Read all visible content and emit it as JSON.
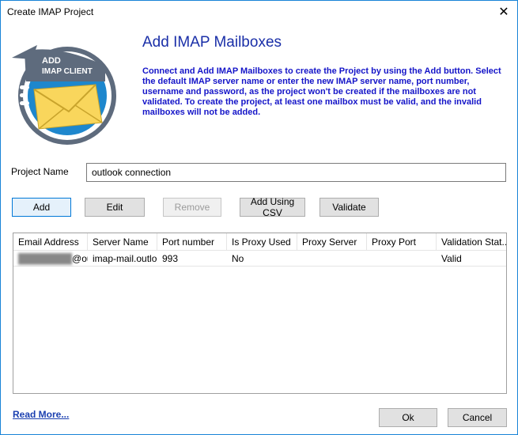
{
  "window": {
    "title": "Create IMAP Project",
    "close_glyph": "✕"
  },
  "logo": {
    "line1": "ADD",
    "line2": "IMAP CLIENT",
    "icon": "envelope-icon"
  },
  "header": {
    "title": "Add IMAP Mailboxes",
    "description": "Connect and Add IMAP Mailboxes to create the Project by using the Add button. Select the default IMAP server name or enter the new IMAP server name, port number, username and password, as the project won't be created if the mailboxes are not validated. To create the project, at least one mailbox must be valid, and the invalid mailboxes will not be added."
  },
  "project": {
    "label": "Project Name",
    "value": "outlook connection"
  },
  "toolbar": {
    "add": "Add",
    "edit": "Edit",
    "remove": "Remove",
    "add_csv": "Add Using CSV",
    "validate": "Validate"
  },
  "grid": {
    "columns": [
      "Email Address",
      "Server Name",
      "Port number",
      "Is Proxy Used",
      "Proxy Server",
      "Proxy Port",
      "Validation Stat..."
    ],
    "rows": [
      {
        "email_hidden": "████████",
        "email_visible": "@outlo...",
        "server": "imap-mail.outlo...",
        "port": "993",
        "proxy_used": "No",
        "proxy_server": "",
        "proxy_port": "",
        "status": "Valid"
      }
    ]
  },
  "footer": {
    "read_more": "Read More...",
    "ok": "Ok",
    "cancel": "Cancel"
  },
  "colors": {
    "heading": "#1a2fa8",
    "description": "#1414c8",
    "window_border": "#1883d7"
  }
}
